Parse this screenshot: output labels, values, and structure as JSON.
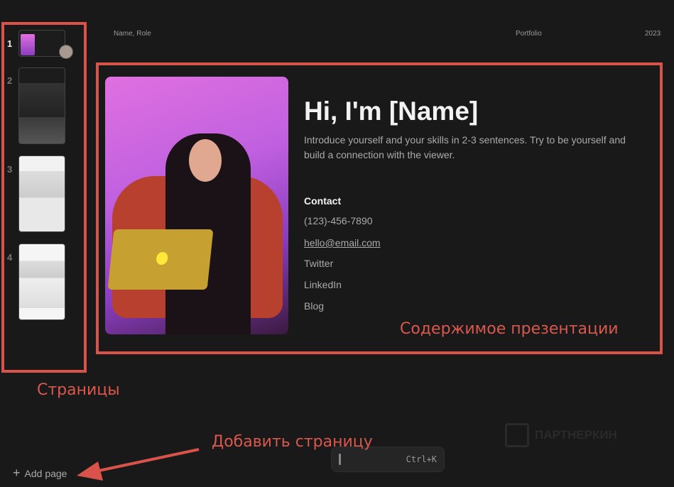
{
  "header": {
    "left": "Name, Role",
    "center": "Portfolio",
    "right": "2023"
  },
  "pages": [
    {
      "number": "1"
    },
    {
      "number": "2"
    },
    {
      "number": "3"
    },
    {
      "number": "4"
    }
  ],
  "slide": {
    "title": "Hi, I'm [Name]",
    "intro": "Introduce yourself and your skills in 2-3 sentences. Try to be yourself and build a connection with the viewer.",
    "contact_heading": "Contact",
    "contacts": [
      "(123)-456-7890",
      "hello@email.com",
      "Twitter",
      "LinkedIn",
      "Blog"
    ]
  },
  "command_bar": {
    "shortcut": "Ctrl+K"
  },
  "add_page": {
    "icon": "plus-icon",
    "label": "Add page"
  },
  "annotations": {
    "pages": "Страницы",
    "content": "Содержимое презентации",
    "add_page": "Добавить страницу"
  },
  "watermark": "ПАРТНЕРКИН",
  "colors": {
    "annotation": "#d9534a",
    "background": "#191919"
  }
}
